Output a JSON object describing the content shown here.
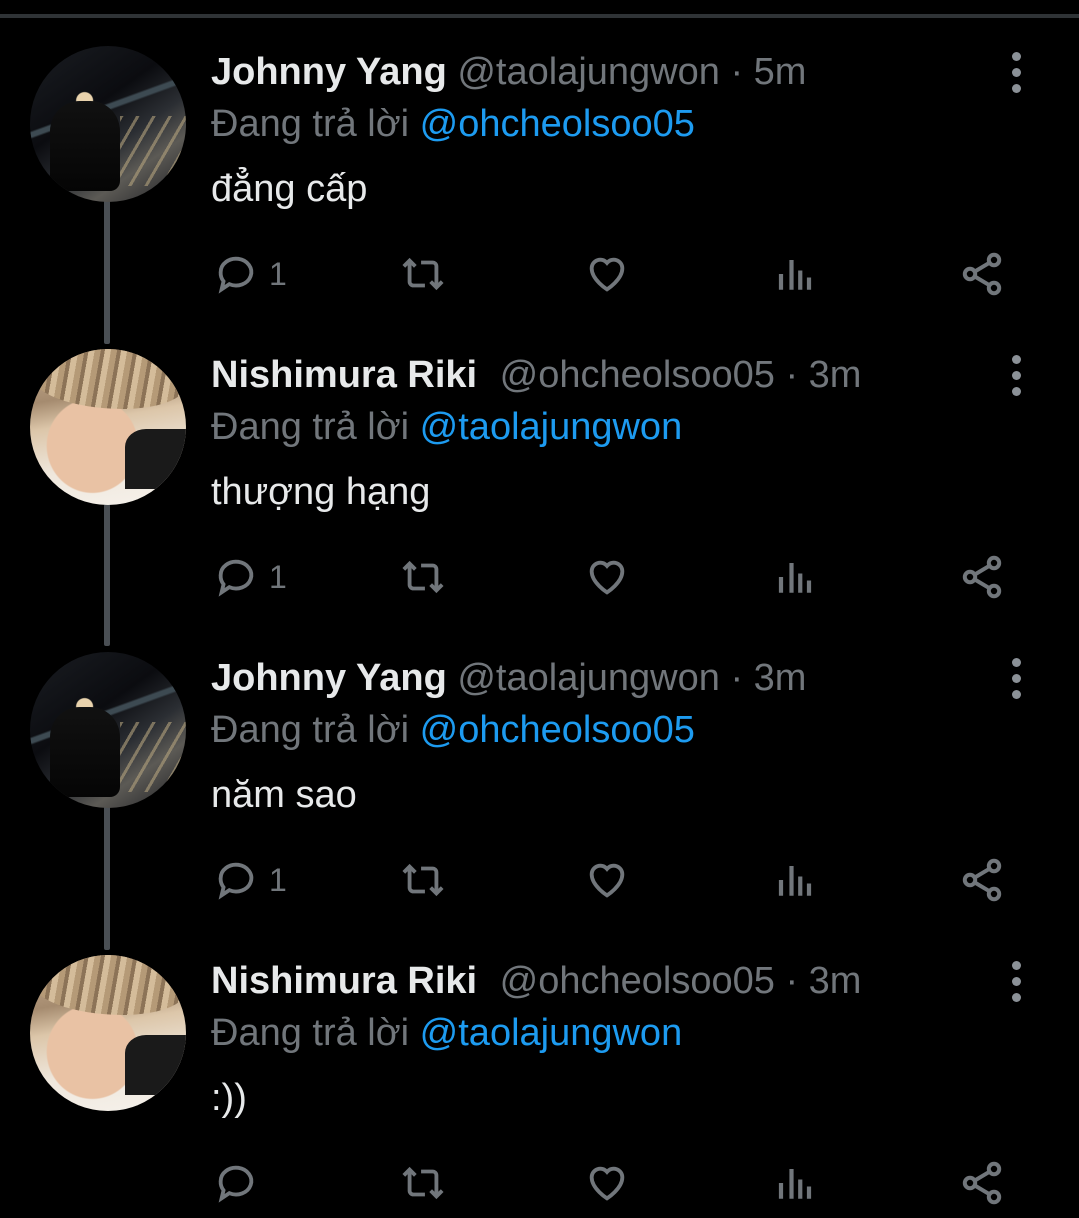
{
  "tweets": [
    {
      "name": "Johnny Yang",
      "handle": "@taolajungwon",
      "time": "5m",
      "reply_prefix": "Đang trả lời",
      "reply_to": "@ohcheolsoo05",
      "text": "đẳng cấp",
      "reply_count": "1",
      "avatar": "night"
    },
    {
      "name": "Nishimura Riki",
      "handle": "@ohcheolsoo05",
      "time": "3m",
      "reply_prefix": "Đang trả lời",
      "reply_to": "@taolajungwon",
      "text": "thượng hạng",
      "reply_count": "1",
      "avatar": "face"
    },
    {
      "name": "Johnny Yang",
      "handle": "@taolajungwon",
      "time": "3m",
      "reply_prefix": "Đang trả lời",
      "reply_to": "@ohcheolsoo05",
      "text": "năm sao",
      "reply_count": "1",
      "avatar": "night"
    },
    {
      "name": "Nishimura Riki",
      "handle": "@ohcheolsoo05",
      "time": "3m",
      "reply_prefix": "Đang trả lời",
      "reply_to": "@taolajungwon",
      "text": ":))",
      "reply_count": "",
      "avatar": "face"
    }
  ],
  "separator": "·",
  "icons": {
    "reply": "reply-icon",
    "retweet": "retweet-icon",
    "like": "like-icon",
    "views": "views-icon",
    "share": "share-icon",
    "more": "more-icon"
  },
  "colors": {
    "background": "#000000",
    "text": "#e7e9ea",
    "muted": "#71767b",
    "link": "#1d9bf0",
    "thread": "#4a4f54"
  }
}
